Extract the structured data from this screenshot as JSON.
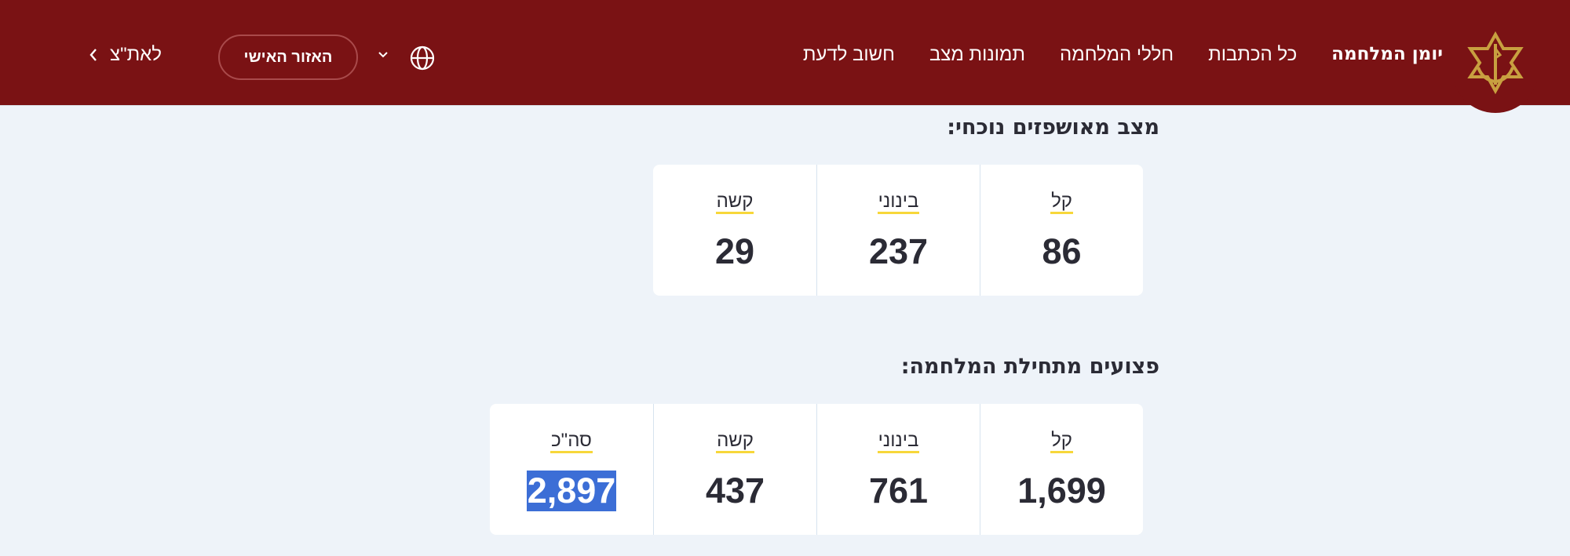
{
  "header": {
    "nav": [
      "יומן המלחמה",
      "כל הכתבות",
      "חללי המלחמה",
      "תמונות מצב",
      "חשוב לדעת"
    ],
    "personal_area_label": "האזור האישי",
    "back_label": "לאת\"צ",
    "colors": {
      "background": "#7a1214",
      "logo": "#c8a040"
    },
    "icons": {
      "logo": "idf-emblem-icon",
      "language": "globe-icon",
      "dropdown": "chevron-down-icon",
      "back": "chevron-left-icon"
    }
  },
  "current_hospitalized": {
    "title": "מצב מאושפזים נוכחי:",
    "cards": [
      {
        "label": "קל",
        "value": "86"
      },
      {
        "label": "בינוני",
        "value": "237"
      },
      {
        "label": "קשה",
        "value": "29"
      }
    ]
  },
  "wounded_since_start": {
    "title": "פצועים מתחילת המלחמה:",
    "cards": [
      {
        "label": "קל",
        "value": "1,699"
      },
      {
        "label": "בינוני",
        "value": "761"
      },
      {
        "label": "קשה",
        "value": "437"
      },
      {
        "label": "סה\"כ",
        "value": "2,897",
        "selected": true
      }
    ]
  },
  "accent_colors": {
    "label_underline": "#f7d73a",
    "selection": "#3c6ed6"
  }
}
